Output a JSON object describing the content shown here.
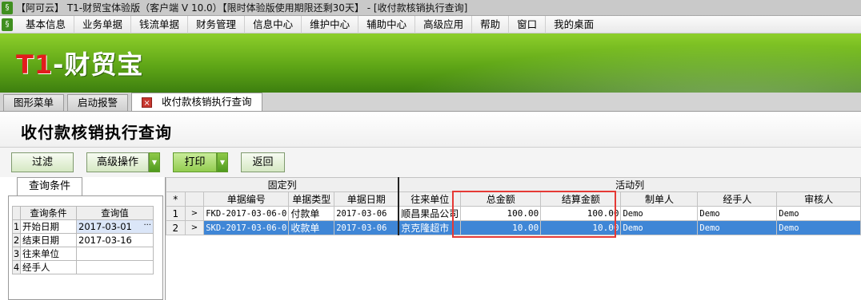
{
  "window": {
    "title": "【阿可云】 T1-财贸宝体验版（客户端 V 10.0）【限时体验版使用期限还剩30天】 - [收付款核销执行查询]"
  },
  "menu": {
    "items": [
      "基本信息",
      "业务单据",
      "钱流单据",
      "财务管理",
      "信息中心",
      "维护中心",
      "辅助中心",
      "高级应用",
      "帮助",
      "窗口",
      "我的桌面"
    ]
  },
  "banner": {
    "logo_prefix": "T1",
    "logo_text": "-财贸宝"
  },
  "tabs": [
    {
      "label": "图形菜单"
    },
    {
      "label": "启动报警"
    },
    {
      "label": "收付款核销执行查询"
    }
  ],
  "page": {
    "title": "收付款核销执行查询"
  },
  "toolbar": {
    "filter": "过滤",
    "advanced": "高级操作",
    "print": "打印",
    "back": "返回"
  },
  "query": {
    "tab_label": "查询条件",
    "headers": [
      "查询条件",
      "查询值"
    ],
    "rows": [
      {
        "num": "1",
        "name": "开始日期",
        "value": "2017-03-01"
      },
      {
        "num": "2",
        "name": "结束日期",
        "value": "2017-03-16"
      },
      {
        "num": "3",
        "name": "往来单位",
        "value": ""
      },
      {
        "num": "4",
        "name": "经手人",
        "value": ""
      }
    ]
  },
  "grid": {
    "group_fixed": "固定列",
    "group_active": "活动列",
    "corner": "*",
    "headers": [
      "单据编号",
      "单据类型",
      "单据日期",
      "往来单位",
      "总金额",
      "结算金额",
      "制单人",
      "经手人",
      "审核人"
    ],
    "rows": [
      {
        "num": "1",
        "ind": ">",
        "code": "FKD-2017-03-06-0",
        "type": "付款单",
        "date": "2017-03-06",
        "unit": "顺昌果品公司",
        "total": "100.00",
        "settle": "100.00",
        "maker": "Demo",
        "handler": "Demo",
        "auditor": "Demo"
      },
      {
        "num": "2",
        "ind": ">",
        "code": "SKD-2017-03-06-0",
        "type": "收款单",
        "date": "2017-03-06",
        "unit": "京克隆超市",
        "total": "10.00",
        "settle": "10.00",
        "maker": "Demo",
        "handler": "Demo",
        "auditor": "Demo"
      }
    ]
  },
  "colors": {
    "banner_green": "#5fa617",
    "selection_blue": "#3f86d6",
    "highlight_red": "#e53935"
  }
}
